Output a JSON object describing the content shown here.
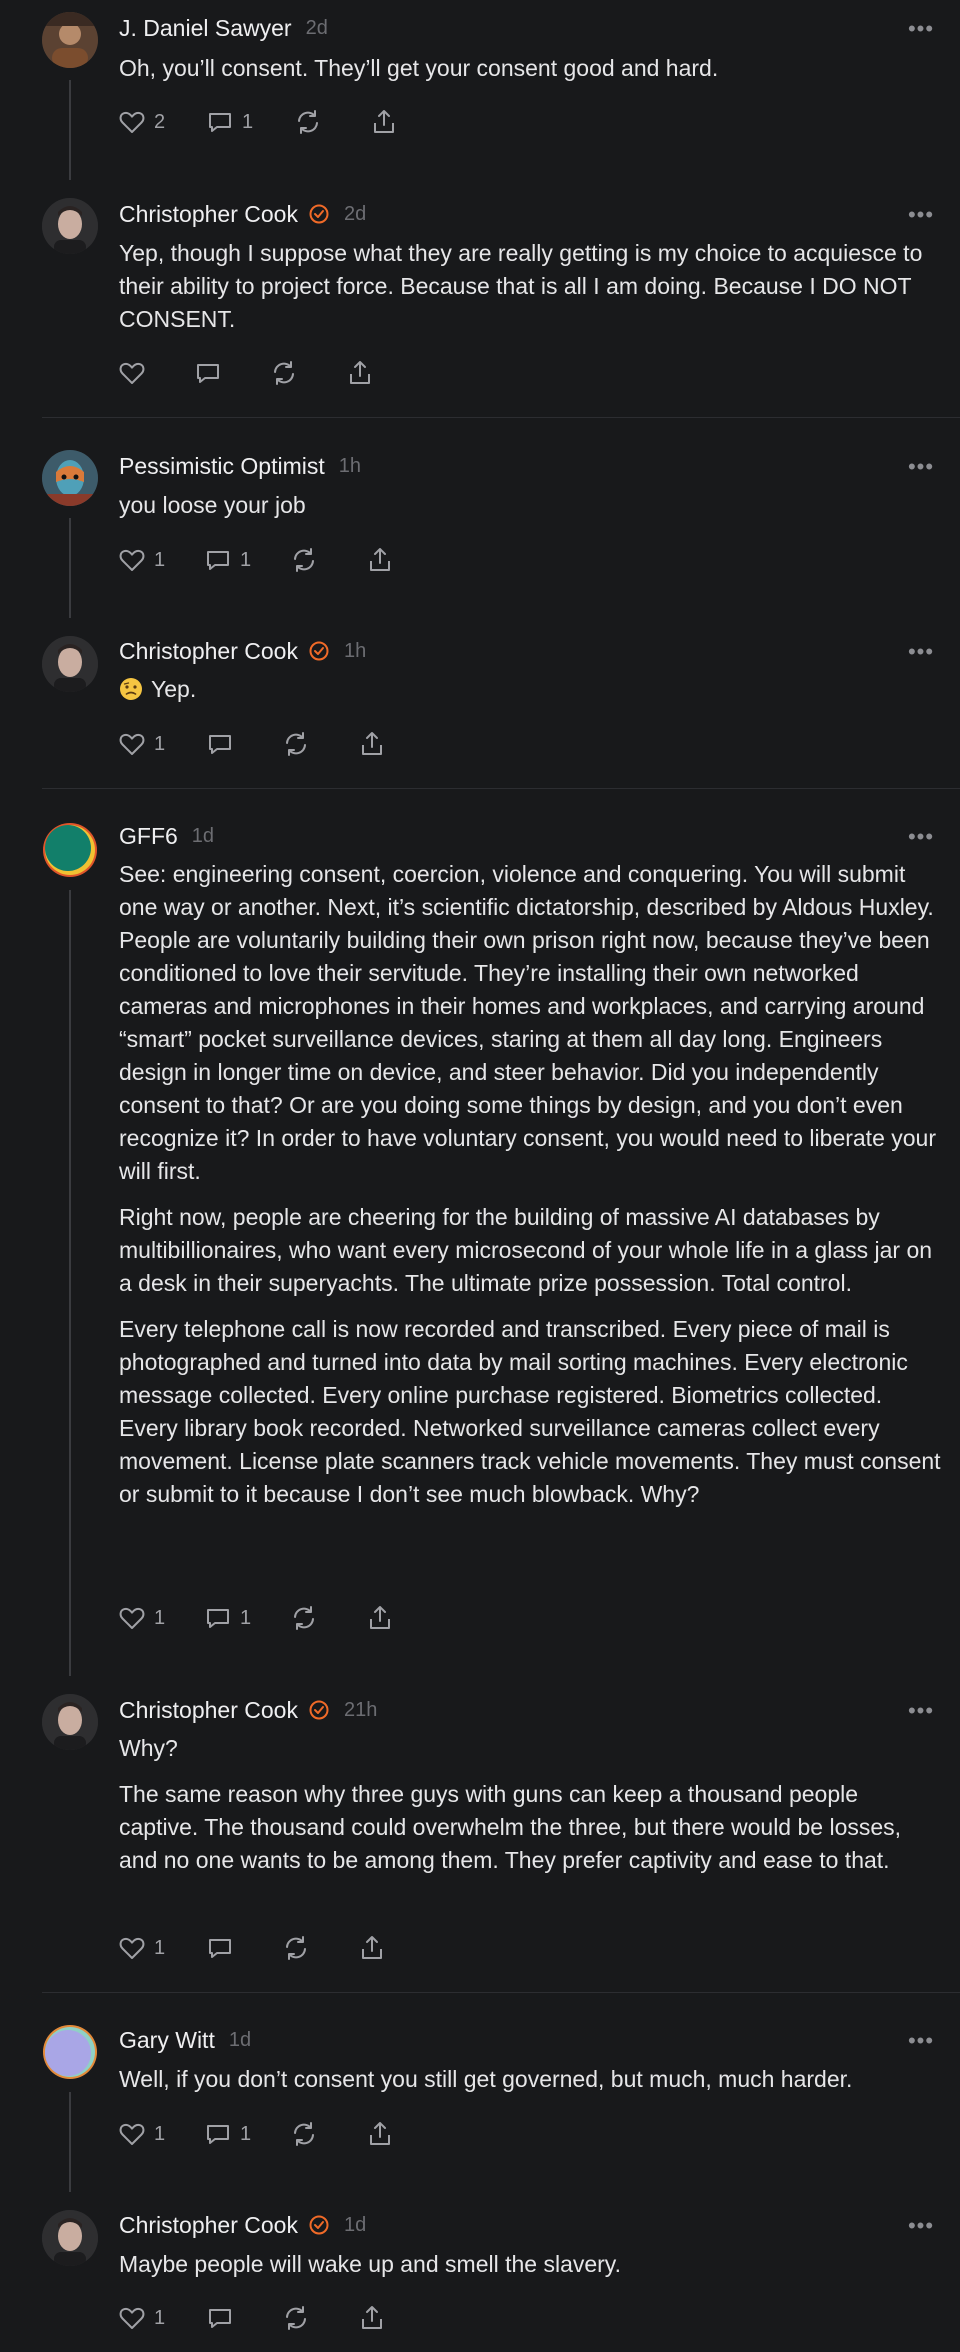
{
  "colors": {
    "background": "#18191b",
    "verified": "#f06a28",
    "thread_line": "#3a3b3f",
    "divider": "#2c2d31"
  },
  "icons": {
    "like": "heart-icon",
    "reply": "speech-bubble-icon",
    "restack": "repost-icon",
    "share": "share-icon",
    "more": "ellipsis-icon",
    "verified": "verified-badge-icon"
  },
  "comments": [
    {
      "author": "J. Daniel Sawyer",
      "time": "2d",
      "verified": false,
      "paragraphs": [
        "Oh, you’ll consent. They’ll get your consent good and hard."
      ],
      "likes": "2",
      "replies": "1"
    },
    {
      "author": "Christopher Cook",
      "time": "2d",
      "verified": true,
      "paragraphs": [
        "Yep, though I suppose what they are really getting is my choice to acquiesce to their ability to project force. Because that is all I am doing. Because I DO NOT CONSENT."
      ],
      "likes": "",
      "replies": ""
    },
    {
      "author": "Pessimistic Optimist",
      "time": "1h",
      "verified": false,
      "paragraphs": [
        "you loose your job"
      ],
      "likes": "1",
      "replies": "1"
    },
    {
      "author": "Christopher Cook",
      "time": "1h",
      "verified": true,
      "paragraphs": [
        "Yep."
      ],
      "likes": "1",
      "replies": ""
    },
    {
      "author": "GFF6",
      "time": "1d",
      "verified": false,
      "paragraphs": [
        "See: engineering consent, coercion, violence and conquering. You will submit one way or another. Next, it’s scientific dictatorship, described by Aldous Huxley. People are voluntarily building their own prison right now, because they’ve been conditioned to love their servitude. They’re installing their own networked cameras and microphones in their homes and workplaces, and carrying around “smart” pocket surveillance devices, staring at them all day long. Engineers design in longer time on device, and steer behavior. Did you independently consent to that? Or are you doing some things by design, and you don’t even recognize it? In order to have voluntary consent, you would need to liberate your will first.",
        "Right now, people are cheering for the building of massive AI databases by multibillionaires, who want every microsecond of your whole life in a glass jar on a desk in their superyachts. The ultimate prize possession. Total control.",
        "Every telephone call is now recorded and transcribed. Every piece of mail is photographed and turned into data by mail sorting machines. Every electronic message collected. Every online purchase registered. Biometrics collected. Every library book recorded. Networked surveillance cameras collect every movement. License plate scanners track vehicle movements. They must consent or submit to it because I don’t see much blowback. Why?"
      ],
      "likes": "1",
      "replies": "1"
    },
    {
      "author": "Christopher Cook",
      "time": "21h",
      "verified": true,
      "paragraphs": [
        "Why?",
        "The same reason why three guys with guns can keep a thousand people captive. The thousand could overwhelm the three, but there would be losses, and no one wants to be among them. They prefer captivity and ease to that."
      ],
      "likes": "1",
      "replies": ""
    },
    {
      "author": "Gary Witt",
      "time": "1d",
      "verified": false,
      "paragraphs": [
        "Well, if you don’t consent you still get governed, but much, much harder."
      ],
      "likes": "1",
      "replies": "1"
    },
    {
      "author": "Christopher Cook",
      "time": "1d",
      "verified": true,
      "paragraphs": [
        "Maybe people will wake up and smell the slavery."
      ],
      "likes": "1",
      "replies": ""
    }
  ]
}
